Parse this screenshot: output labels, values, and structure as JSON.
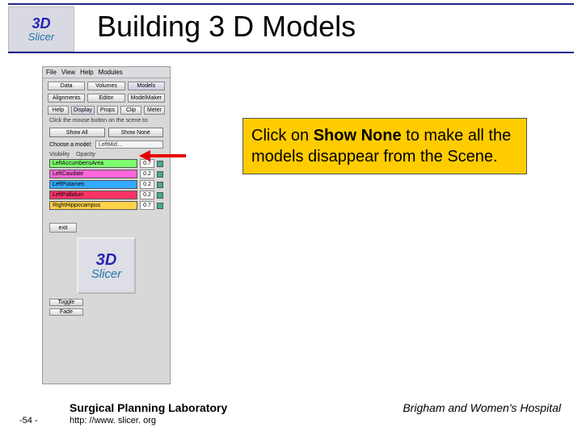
{
  "header": {
    "logo_top": "3D",
    "logo_bottom": "Slicer",
    "title": "Building 3 D Models"
  },
  "panel": {
    "menubar": [
      "File",
      "View",
      "Help",
      "Modules"
    ],
    "row1": [
      "Data",
      "Volumes",
      "Models"
    ],
    "row2": [
      "Alignments",
      "Editor",
      "ModelMaker"
    ],
    "row3": [
      "Help",
      "Display",
      "Props",
      "Clip",
      "Meter"
    ],
    "instruction": "Click the mouse button on the scene to:",
    "show_all": "Show All",
    "show_none": "Show None",
    "choose_label": "Choose a model:",
    "choose_value": "LeftMid…",
    "table_headers": {
      "visibility": "Visibility",
      "opacity": "Opacity"
    },
    "models": [
      {
        "name": "LeftAccumbensArea",
        "color": "#7fff6f",
        "value": "0.7"
      },
      {
        "name": "LeftCaudate",
        "color": "#ff66d9",
        "value": "0.2"
      },
      {
        "name": "LeftPutamen",
        "color": "#33aaff",
        "value": "0.2"
      },
      {
        "name": "LeftPallidum",
        "color": "#ff3366",
        "value": "0.2"
      },
      {
        "name": "RightHippocampus",
        "color": "#ffd24a",
        "value": "0.7"
      }
    ],
    "exit": "exit",
    "bottom_buttons": [
      "Toggle",
      "Fade"
    ],
    "thumb": {
      "top": "3D",
      "bottom": "Slicer"
    }
  },
  "callout": {
    "pre": "Click on ",
    "bold": "Show None",
    "post": " to make all the models disappear from the Scene."
  },
  "footer": {
    "lab": "Surgical Planning Laboratory",
    "url": "http: //www. slicer. org",
    "page": "-54 -",
    "right": "Brigham and Women's Hospital"
  }
}
